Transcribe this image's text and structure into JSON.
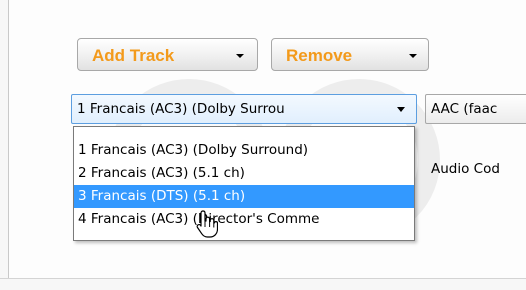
{
  "toolbar": {
    "add_track_label": "Add Track",
    "remove_label": "Remove"
  },
  "track_select": {
    "selected_value": "1 Francais (AC3) (Dolby Surrou",
    "options": [
      "1 Francais (AC3) (Dolby Surround)",
      "2 Francais (AC3) (5.1 ch)",
      "3 Francais (DTS) (5.1 ch)",
      "4 Francais (AC3) (Director's Comme"
    ],
    "highlighted_index": 2
  },
  "codec_select": {
    "selected_value": "AAC (faac"
  },
  "columns": {
    "audio_codec_label": "Audio Cod"
  },
  "colors": {
    "button_text": "#f39a1b",
    "selection_bg": "#3399ff",
    "combo_border": "#5c9ee0"
  },
  "icons": {
    "cursor": "hand-pointer-icon",
    "dropdown_arrow": "chevron-down-icon"
  }
}
